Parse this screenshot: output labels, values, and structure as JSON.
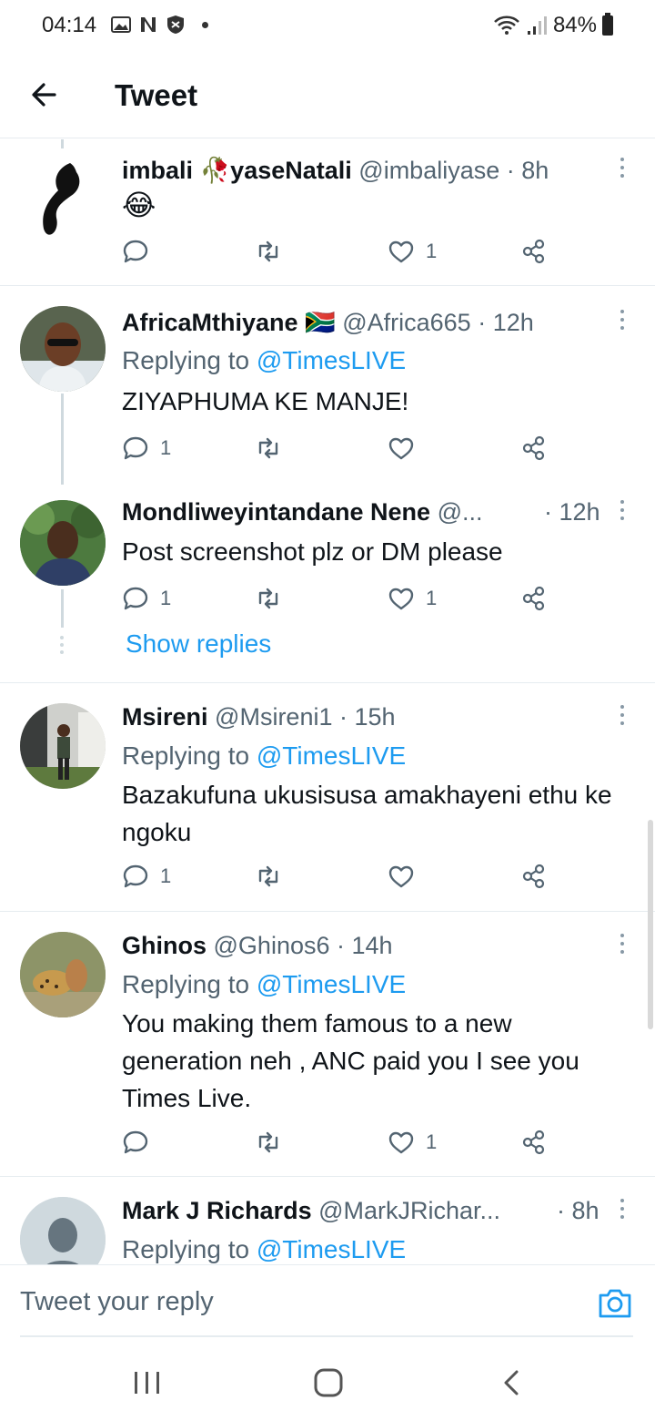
{
  "status_bar": {
    "time": "04:14",
    "battery": "84%"
  },
  "header": {
    "title": "Tweet"
  },
  "tweets": [
    {
      "name": "imbali",
      "name_emoji": "🥀",
      "name_suffix": "yaseNatali",
      "handle": "@imbaliyase",
      "time": "· 8h",
      "text": "😂",
      "reply_count": "",
      "like_count": "1"
    },
    {
      "name": "AfricaMthiyane",
      "name_emoji": "🇿🇦",
      "handle": "@Africa665",
      "time": "· 12h",
      "replying_prefix": "Replying to",
      "replying_to": "@TimesLIVE",
      "text": "ZIYAPHUMA KE MANJE!",
      "reply_count": "1",
      "like_count": ""
    },
    {
      "name": "Mondliweyintandane Nene",
      "handle": "@...",
      "time": "· 12h",
      "text": "Post screenshot  plz or DM please",
      "reply_count": "1",
      "like_count": "1",
      "show_replies": "Show replies"
    },
    {
      "name": "Msireni",
      "handle": "@Msireni1",
      "time": "· 15h",
      "replying_prefix": "Replying to",
      "replying_to": "@TimesLIVE",
      "text": "Bazakufuna ukusisusa amakhayeni ethu ke ngoku",
      "reply_count": "1",
      "like_count": ""
    },
    {
      "name": "Ghinos",
      "handle": "@Ghinos6",
      "time": "· 14h",
      "replying_prefix": "Replying to",
      "replying_to": "@TimesLIVE",
      "text": "You making them famous to a new generation neh , ANC paid you I see you Times Live.",
      "reply_count": "",
      "like_count": "1"
    },
    {
      "name": "Mark J Richards",
      "handle": "@MarkJRichar...",
      "time": "· 8h",
      "replying_prefix": "Replying to",
      "replying_to": "@TimesLIVE"
    }
  ],
  "reply_bar": {
    "placeholder": "Tweet your reply"
  },
  "icons": {
    "back": "arrow-left-icon",
    "reply": "comment-icon",
    "retweet": "retweet-icon",
    "like": "heart-icon",
    "share": "share-icon",
    "more": "more-vertical-icon",
    "camera": "camera-icon"
  },
  "colors": {
    "accent": "#1d9bf0",
    "text_secondary": "#536471",
    "divider": "#e6ecf0"
  }
}
